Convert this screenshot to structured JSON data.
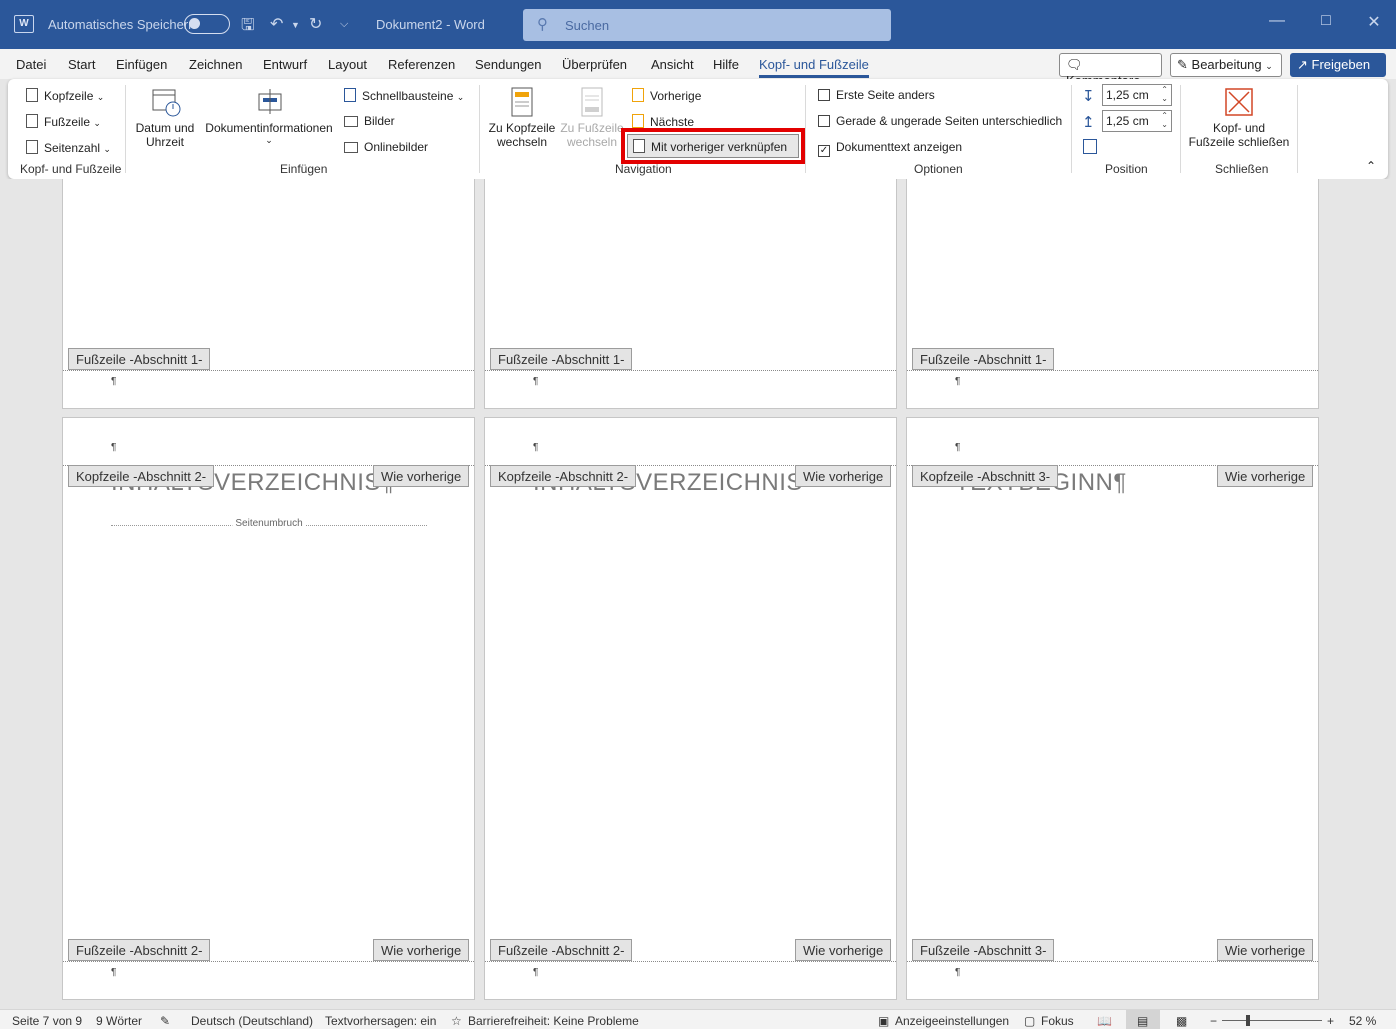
{
  "titlebar": {
    "autosave_label": "Automatisches Speichern",
    "document_title": "Dokument2 - Word",
    "search_placeholder": "Suchen"
  },
  "menu": {
    "tabs": [
      "Datei",
      "Start",
      "Einfügen",
      "Zeichnen",
      "Entwurf",
      "Layout",
      "Referenzen",
      "Sendungen",
      "Überprüfen",
      "Ansicht",
      "Hilfe",
      "Kopf- und Fußzeile"
    ],
    "active_tab": "Kopf- und Fußzeile",
    "comments_label": "Kommentare",
    "editing_label": "Bearbeitung",
    "share_label": "Freigeben"
  },
  "ribbon": {
    "header_label": "Kopfzeile",
    "footer_label": "Fußzeile",
    "page_number_label": "Seitenzahl",
    "group_header_footer": "Kopf- und Fußzeile",
    "date_time_line1": "Datum und",
    "date_time_line2": "Uhrzeit",
    "doc_info_label": "Dokumentinformationen",
    "quick_parts_label": "Schnellbausteine",
    "pictures_label": "Bilder",
    "online_pictures_label": "Onlinebilder",
    "group_insert": "Einfügen",
    "goto_header_line1": "Zu Kopfzeile",
    "goto_header_line2": "wechseln",
    "goto_footer_line1": "Zu Fußzeile",
    "goto_footer_line2": "wechseln",
    "previous_label": "Vorherige",
    "next_label": "Nächste",
    "link_previous_label": "Mit vorheriger verknüpfen",
    "group_navigation": "Navigation",
    "different_first_page": "Erste Seite anders",
    "different_odd_even": "Gerade & ungerade Seiten unterschiedlich",
    "show_document_text": "Dokumenttext anzeigen",
    "group_options": "Optionen",
    "header_position_value": "1,25 cm",
    "footer_position_value": "1,25 cm",
    "group_position": "Position",
    "close_line1": "Kopf- und",
    "close_line2": "Fußzeile schließen",
    "group_close": "Schließen"
  },
  "pages": {
    "footer_s1": "Fußzeile -Abschnitt 1-",
    "header_s2": "Kopfzeile -Abschnitt 2-",
    "footer_s2": "Fußzeile -Abschnitt 2-",
    "header_s3": "Kopfzeile -Abschnitt 3-",
    "footer_s3": "Fußzeile -Abschnitt 3-",
    "same_as_previous": "Wie vorherige",
    "heading_toc_1": "INHALTSVERZEICHNIS¶",
    "heading_toc_2": "INHALTSVERZEICHNIS",
    "heading_textbeginn": "TEXTBEGINN¶",
    "page_break": "Seitenumbruch",
    "pilcrow": "¶"
  },
  "statusbar": {
    "page_info": "Seite 7 von 9",
    "word_count": "9 Wörter",
    "language": "Deutsch (Deutschland)",
    "text_predictions": "Textvorhersagen: ein",
    "accessibility": "Barrierefreiheit: Keine Probleme",
    "display_settings": "Anzeigeeinstellungen",
    "focus": "Fokus",
    "zoom": "52 %"
  },
  "colors": {
    "title_bar": "#2b579a",
    "highlight_box": "#e30000"
  }
}
